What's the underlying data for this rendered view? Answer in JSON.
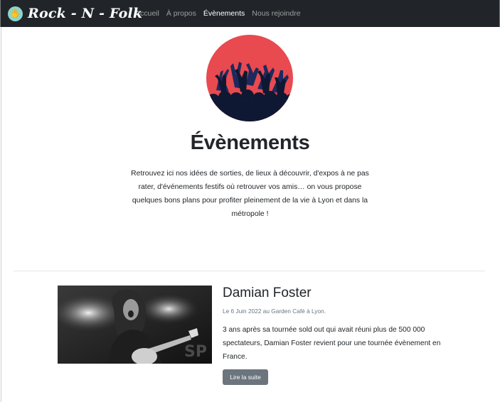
{
  "navbar": {
    "brand": "Rock - N - Folk",
    "brand_icon": "hand-icon",
    "links": [
      {
        "label": "Accueil",
        "active": false
      },
      {
        "label": "À propos",
        "active": false
      },
      {
        "label": "Évènements",
        "active": true
      },
      {
        "label": "Nous rejoindre",
        "active": false
      }
    ]
  },
  "hero": {
    "image": "crowd-hands-icon",
    "title": "Évènements",
    "lead": "Retrouvez ici nos idées de sorties, de lieux à découvrir, d'expos à ne pas rater, d'événements festifs où retrouver vos amis… on vous propose quelques bons plans pour profiter pleinement de la vie à Lyon et dans la métropole !"
  },
  "event": {
    "photo": "guitarist-photo",
    "title": "Damian Foster",
    "meta": "Le 6 Juin 2022 au Garden Café à Lyon.",
    "description": "3 ans après sa tournée sold out qui avait réuni plus de 500 000 spectateurs, Damian Foster revient pour une tournée évènement en France.",
    "button_label": "Lire la suite"
  },
  "colors": {
    "navbar_bg": "#212529",
    "hero_red": "#e84a4f",
    "hero_navy": "#0f1833",
    "button_bg": "#6c757d"
  }
}
